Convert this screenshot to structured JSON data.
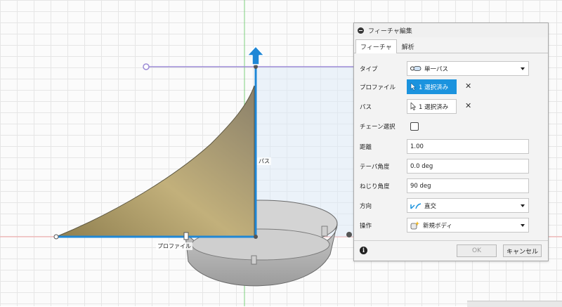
{
  "viewport": {
    "path_label": "パス",
    "profile_label": "プロファイル"
  },
  "panel": {
    "title": "フィーチャ編集",
    "tabs": [
      "フィーチャ",
      "解析"
    ],
    "rows": {
      "type": {
        "label": "タイプ",
        "value": "単一パス",
        "icon": "single-path-icon"
      },
      "profile": {
        "label": "プロファイル",
        "value": "1 選択済み",
        "icon": "cursor-arrow-icon"
      },
      "path": {
        "label": "パス",
        "value": "1 選択済み",
        "icon": "cursor-arrow-icon"
      },
      "chain": {
        "label": "チェーン選択",
        "checked": false
      },
      "distance": {
        "label": "距離",
        "value": "1.00"
      },
      "taper": {
        "label": "テーパ角度",
        "value": "0.0 deg"
      },
      "twist": {
        "label": "ねじり角度",
        "value": "90 deg"
      },
      "orientation": {
        "label": "方向",
        "value": "直交",
        "icon": "orientation-icon"
      },
      "operation": {
        "label": "操作",
        "value": "新規ボディ",
        "icon": "new-body-icon"
      }
    },
    "ok_label": "OK",
    "cancel_label": "キャンセル",
    "info_glyph": "i",
    "clear_glyph": "✕"
  },
  "colors": {
    "accent": "#1b93de",
    "path_line": "#1f87d6",
    "sweep_body": "#b7a577",
    "sketch_line": "#9b8ad6"
  }
}
